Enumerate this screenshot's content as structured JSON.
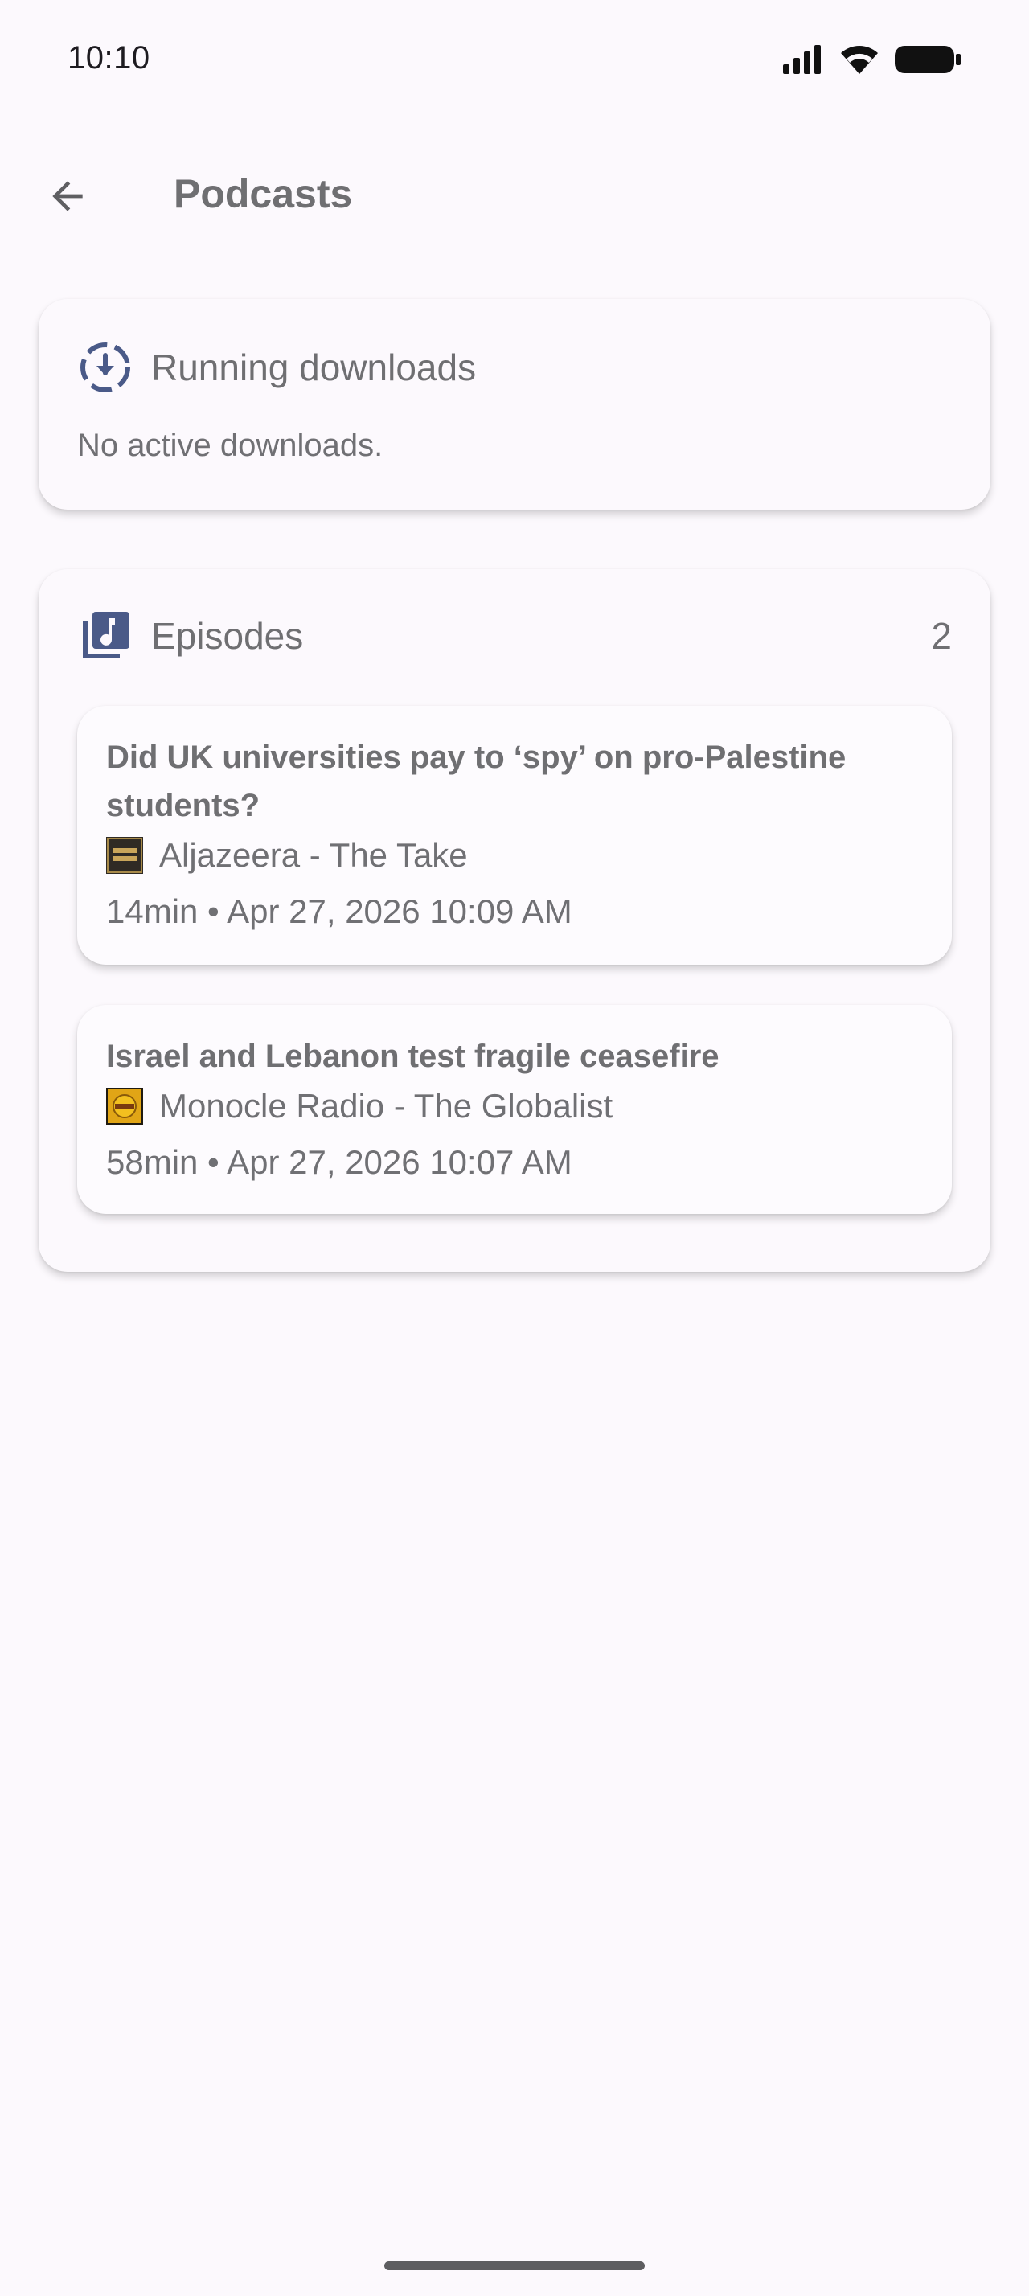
{
  "status_bar": {
    "time": "10:10"
  },
  "app_bar": {
    "title": "Podcasts",
    "back_icon": "arrow-back-icon"
  },
  "downloads_card": {
    "icon": "download-progress-icon",
    "title": "Running downloads",
    "empty_text": "No active downloads."
  },
  "episodes_card": {
    "icon": "music-library-icon",
    "title": "Episodes",
    "count": "2",
    "items": [
      {
        "title": "Did UK universities pay to ‘spy’ on pro-Palestine students?",
        "source": "Aljazeera - The Take",
        "meta": "14min • Apr 27, 2026 10:09 AM"
      },
      {
        "title": "Israel and Lebanon test fragile ceasefire",
        "source": "Monocle Radio - The Globalist",
        "meta": "58min • Apr 27, 2026 10:07 AM"
      }
    ]
  },
  "colors": {
    "background": "#fcf9fd",
    "accent_icon": "#4a5a88",
    "text": "#6f6f72"
  }
}
